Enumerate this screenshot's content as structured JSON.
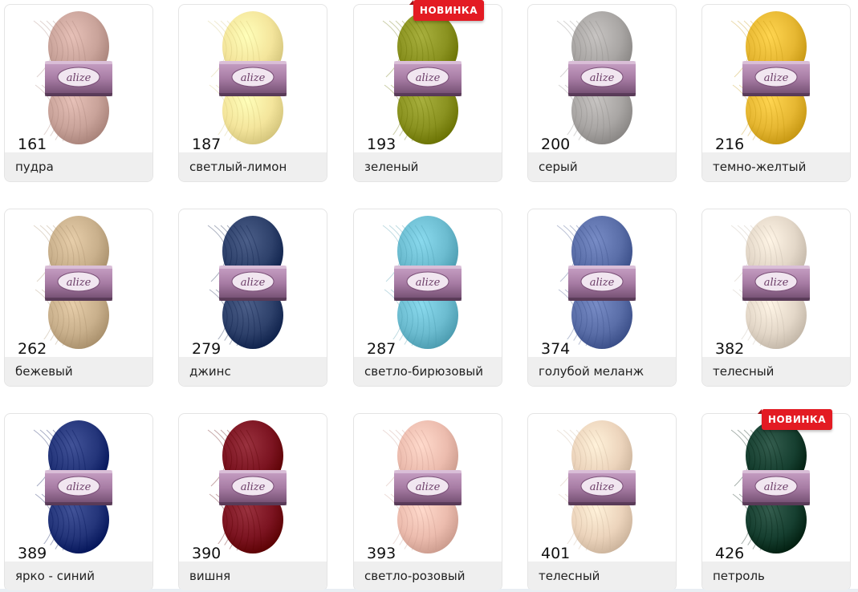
{
  "products": [
    {
      "code": "161",
      "name": "пудра",
      "color": "#c9a39a",
      "badge": ""
    },
    {
      "code": "187",
      "name": "светлый-лимон",
      "color": "#f4e59c",
      "badge": ""
    },
    {
      "code": "193",
      "name": "зеленый",
      "color": "#8a9220",
      "badge": "НОВИНКА"
    },
    {
      "code": "200",
      "name": "серый",
      "color": "#a9a6a4",
      "badge": ""
    },
    {
      "code": "216",
      "name": "темно-желтый",
      "color": "#e6b732",
      "badge": ""
    },
    {
      "code": "262",
      "name": "бежевый",
      "color": "#c9b08c",
      "badge": ""
    },
    {
      "code": "279",
      "name": "джинс",
      "color": "#2e416b",
      "badge": ""
    },
    {
      "code": "287",
      "name": "светло-бирюзовый",
      "color": "#6cbcd0",
      "badge": ""
    },
    {
      "code": "374",
      "name": "голубой меланж",
      "color": "#5a6ea8",
      "badge": ""
    },
    {
      "code": "382",
      "name": "телесный",
      "color": "#e3d7c8",
      "badge": ""
    },
    {
      "code": "389",
      "name": "ярко - синий",
      "color": "#24357a",
      "badge": ""
    },
    {
      "code": "390",
      "name": "вишня",
      "color": "#7c1421",
      "badge": ""
    },
    {
      "code": "393",
      "name": "светло-розовый",
      "color": "#ecbcae",
      "badge": ""
    },
    {
      "code": "401",
      "name": "телесный",
      "color": "#ecd4bc",
      "badge": ""
    },
    {
      "code": "426",
      "name": "петроль",
      "color": "#163f30",
      "badge": "НОВИНКА"
    }
  ],
  "label_brand": "alize",
  "label_color": "#a77ca4",
  "icons": {
    "badge": "new-badge-ribbon",
    "skein": "yarn-skein-image"
  }
}
